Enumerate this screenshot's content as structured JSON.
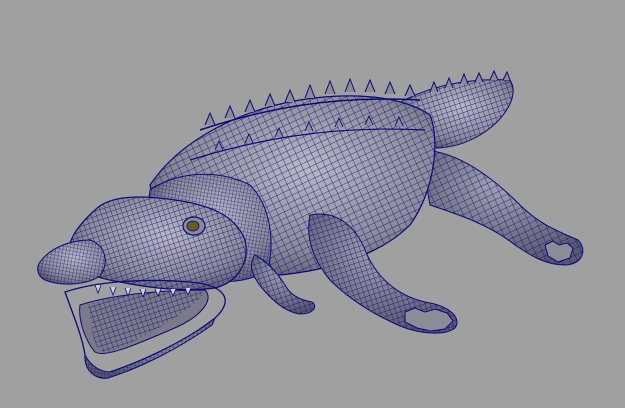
{
  "viewport": {
    "background": "#a0a0a0",
    "display_mode": "wireframe-on-shaded"
  },
  "model": {
    "subject": "alligator",
    "shaded_color": "#8c8c94",
    "wire_color": "#0a0a7a",
    "eye_color": "#6b5a1e"
  }
}
